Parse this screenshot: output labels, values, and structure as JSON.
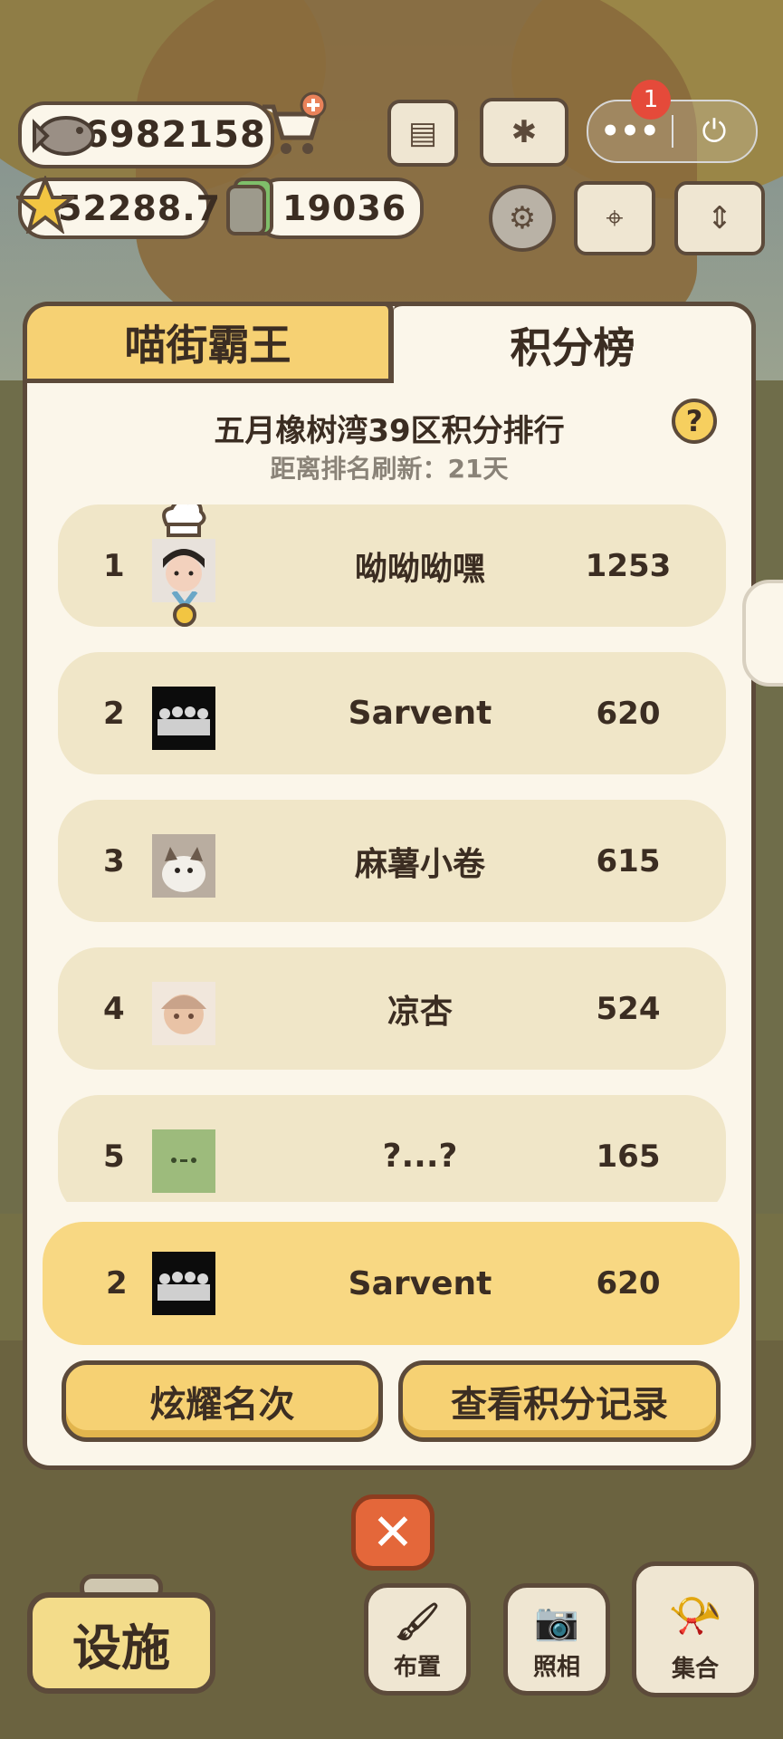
{
  "currency": {
    "fish": "6982158",
    "stars": "52288.7",
    "tickets": "19036"
  },
  "system": {
    "more_label": "•••",
    "notification_count": "1",
    "power_label": "⏻"
  },
  "tabs": [
    {
      "label": "喵街霸王",
      "active": false
    },
    {
      "label": "积分榜",
      "active": true
    }
  ],
  "leaderboard": {
    "title": "五月橡树湾39区积分排行",
    "refresh": "距离排名刷新：21天",
    "help_label": "?",
    "entries": [
      {
        "rank": "1",
        "name": "呦呦呦嘿",
        "score": "1253"
      },
      {
        "rank": "2",
        "name": "Sarvent",
        "score": "620"
      },
      {
        "rank": "3",
        "name": "麻薯小卷",
        "score": "615"
      },
      {
        "rank": "4",
        "name": "凉杏",
        "score": "524"
      },
      {
        "rank": "5",
        "name": "?...?",
        "score": "165"
      }
    ],
    "me": {
      "rank": "2",
      "name": "Sarvent",
      "score": "620"
    }
  },
  "actions": {
    "show_rank": "炫耀名次",
    "view_history": "查看积分记录",
    "close": "✕"
  },
  "bottom_bar": {
    "facility": "设施",
    "layout": "布置",
    "photo": "照相",
    "gather": "集合"
  },
  "colors": {
    "accent_yellow": "#f6d173",
    "panel_bg": "#fbf6ea",
    "row_bg": "#f0e6c8",
    "border_brown": "#5c4a3a",
    "close_orange": "#e4673a"
  }
}
